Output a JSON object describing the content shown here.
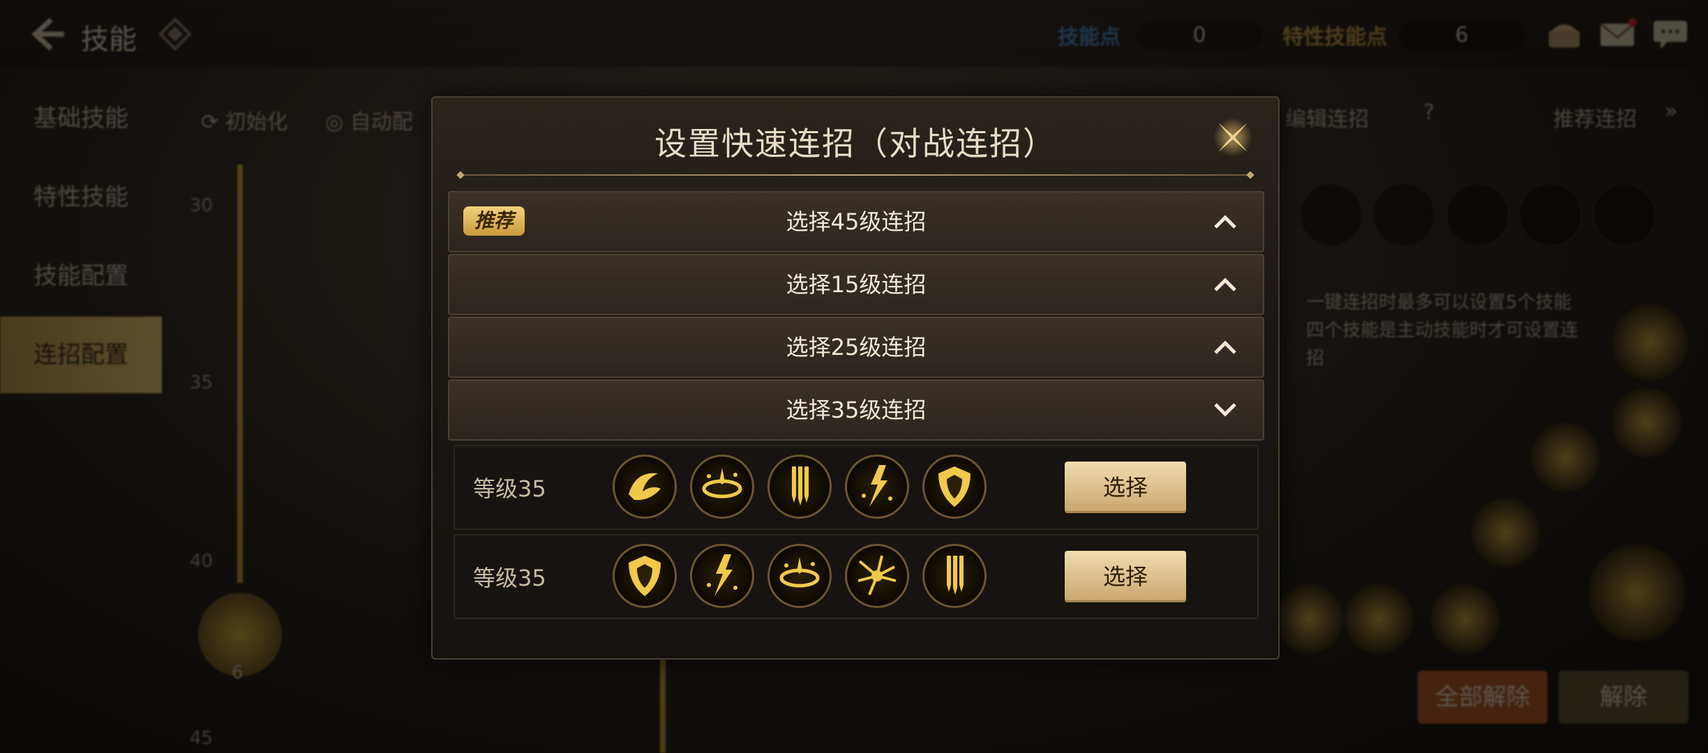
{
  "topbar": {
    "title": "技能",
    "skill_points_label": "技能点",
    "skill_points_value": "0",
    "trait_points_label": "特性技能点",
    "trait_points_value": "6"
  },
  "sidebar": {
    "items": [
      {
        "label": "基础技能"
      },
      {
        "label": "特性技能"
      },
      {
        "label": "技能配置"
      },
      {
        "label": "连招配置"
      }
    ]
  },
  "background": {
    "reset_label": "初始化",
    "auto_label": "自动配",
    "edit_combo_label": "编辑连招",
    "recommend_label": "推荐连招",
    "ticks": [
      "30",
      "35",
      "40",
      "45"
    ],
    "skill_count": "6",
    "description": "一键连招时最多可以设置5个技能 四个技能是主动技能时才可设置连招",
    "release_all_label": "全部解除",
    "release_label": "解除"
  },
  "modal": {
    "title": "设置快速连招（对战连招）",
    "sections": [
      {
        "label": "选择45级连招",
        "badge": "推荐",
        "expanded": false
      },
      {
        "label": "选择15级连招",
        "expanded": false
      },
      {
        "label": "选择25级连招",
        "expanded": false
      },
      {
        "label": "选择35级连招",
        "expanded": true
      }
    ],
    "rows": [
      {
        "level": "等级35",
        "skills": [
          "swirl-slash-icon",
          "ring-burst-icon",
          "falling-swords-icon",
          "lightning-strike-icon",
          "shield-icon"
        ],
        "button": "选择"
      },
      {
        "level": "等级35",
        "skills": [
          "shield-icon",
          "lightning-strike-icon",
          "ring-burst-icon",
          "radiant-burst-icon",
          "falling-swords-icon"
        ],
        "button": "选择"
      }
    ]
  },
  "colors": {
    "accent_gold": "#c99a3b",
    "button_gold": "#e5c891",
    "active_tab": "#d8b55c"
  }
}
